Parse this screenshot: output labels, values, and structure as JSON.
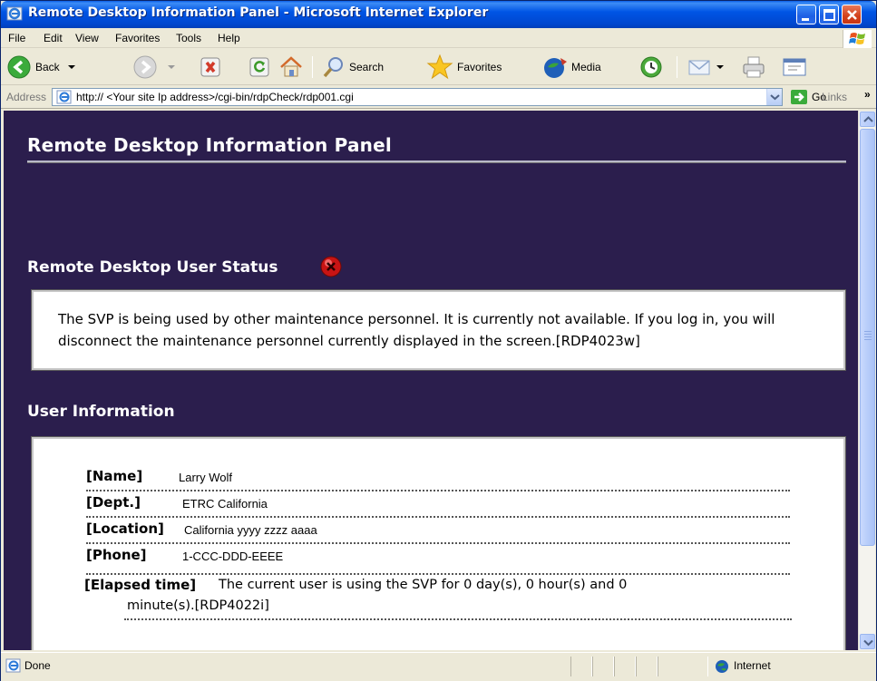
{
  "window": {
    "title": "Remote Desktop Information Panel - Microsoft Internet Explorer"
  },
  "menu": [
    "File",
    "Edit",
    "View",
    "Favorites",
    "Tools",
    "Help"
  ],
  "toolbar": {
    "back_label": "Back",
    "search_label": "Search",
    "favorites_label": "Favorites",
    "media_label": "Media"
  },
  "address": {
    "label": "Address",
    "url": "http:// <Your site Ip address>/cgi-bin/rdpCheck/rdp001.cgi",
    "go_label": "Go",
    "links_label": "Links"
  },
  "page": {
    "heading": "Remote Desktop Information Panel",
    "status_heading": "Remote Desktop User Status",
    "status_message": "The SVP is being used by other maintenance personnel. It is currently not available. If you log in, you will disconnect the maintenance personnel currently displayed in the screen.[RDP4023w]",
    "user_info_heading": "User Information",
    "user_info": {
      "name_label": "[Name]",
      "name": "Larry Wolf",
      "dept_label": "[Dept.]",
      "dept": "ETRC California",
      "location_label": "[Location]",
      "location": "California yyyy zzzz aaaa",
      "phone_label": "[Phone]",
      "phone": "1-CCC-DDD-EEEE",
      "elapsed_label": "[Elapsed time]",
      "elapsed_line1": "The current user is using the SVP for 0 day(s), 0 hour(s) and 0",
      "elapsed_line2": "minute(s).[RDP4022i]"
    }
  },
  "statusbar": {
    "status": "Done",
    "zone": "Internet"
  },
  "colors": {
    "page_background": "#2b1e4d",
    "titlebar_blue": "#0055e5",
    "status_icon_red": "#c81414"
  }
}
